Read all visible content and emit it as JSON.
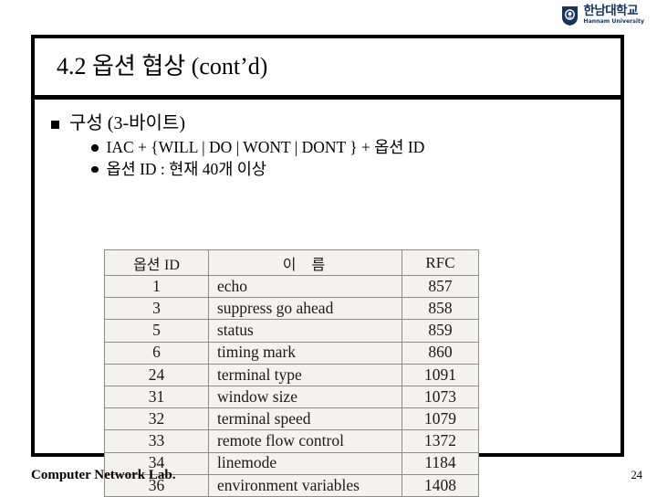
{
  "logo": {
    "icon": "shield-emblem-icon",
    "korean_name": "한남대학교",
    "english_name": "Hannam University",
    "color": "#15335f"
  },
  "slide": {
    "title": "4.2 옵션 협상 (cont’d)",
    "bullets": [
      {
        "level": 1,
        "marker": "square-bullet",
        "text": "구성 (3-바이트)"
      },
      {
        "level": 2,
        "marker": "round-bullet",
        "text": "IAC + {WILL | DO | WONT | DONT } + 옵션 ID"
      },
      {
        "level": 2,
        "marker": "round-bullet",
        "text": "옵션 ID : 현재 40개 이상"
      }
    ]
  },
  "options_table": {
    "headers": {
      "id_kr": "옵션",
      "id_en": "ID",
      "name_kr": "이 름",
      "rfc": "RFC"
    },
    "rows": [
      {
        "id": "1",
        "name": "echo",
        "rfc": "857"
      },
      {
        "id": "3",
        "name": "suppress go ahead",
        "rfc": "858"
      },
      {
        "id": "5",
        "name": "status",
        "rfc": "859"
      },
      {
        "id": "6",
        "name": "timing mark",
        "rfc": "860"
      },
      {
        "id": "24",
        "name": "terminal type",
        "rfc": "1091"
      },
      {
        "id": "31",
        "name": "window size",
        "rfc": "1073"
      },
      {
        "id": "32",
        "name": "terminal speed",
        "rfc": "1079"
      },
      {
        "id": "33",
        "name": "remote flow control",
        "rfc": "1372"
      },
      {
        "id": "34",
        "name": "linemode",
        "rfc": "1184"
      },
      {
        "id": "36",
        "name": "environment variables",
        "rfc": "1408"
      }
    ]
  },
  "footer": {
    "lab_name": "Computer Network Lab.",
    "slide_number": "24"
  }
}
